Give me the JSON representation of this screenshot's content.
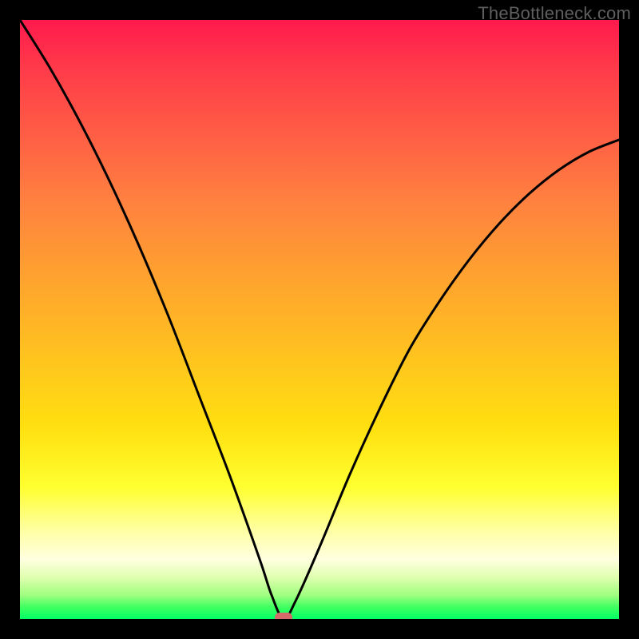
{
  "watermark": "TheBottleneck.com",
  "colors": {
    "page_bg": "#000000",
    "watermark_text": "#5f5f5f",
    "curve_stroke": "#000000",
    "marker_fill": "#d46a6a",
    "gradient_top": "#ff1a4d",
    "gradient_bottom": "#00ff66"
  },
  "chart_data": {
    "type": "line",
    "title": "",
    "xlabel": "",
    "ylabel": "",
    "xlim": [
      0,
      100
    ],
    "ylim": [
      0,
      100
    ],
    "grid": false,
    "legend": false,
    "description": "Bottleneck curve on a red-to-green vertical gradient. Two branches descend from the top—one from the left edge and one from the right edge—meeting at a minimum near x≈44 where bottleneck ≈0.",
    "series": [
      {
        "name": "bottleneck-curve",
        "x": [
          0,
          5,
          10,
          15,
          20,
          25,
          30,
          35,
          40,
          42,
          44,
          46,
          50,
          55,
          60,
          65,
          70,
          75,
          80,
          85,
          90,
          95,
          100
        ],
        "values": [
          100,
          92,
          83,
          73,
          62,
          50,
          37,
          24,
          10,
          4,
          0,
          3,
          12,
          24,
          35,
          45,
          53,
          60,
          66,
          71,
          75,
          78,
          80
        ]
      }
    ],
    "marker": {
      "x": 44,
      "y": 0,
      "shape": "rounded-rect",
      "color": "#d46a6a"
    },
    "background_gradient": {
      "direction": "top-to-bottom",
      "stops": [
        {
          "pos": 0.0,
          "color": "#ff1a4d"
        },
        {
          "pos": 0.3,
          "color": "#ff8040"
        },
        {
          "pos": 0.55,
          "color": "#ffc020"
        },
        {
          "pos": 0.78,
          "color": "#ffff30"
        },
        {
          "pos": 0.93,
          "color": "#e0ffb0"
        },
        {
          "pos": 1.0,
          "color": "#00ff66"
        }
      ]
    }
  }
}
